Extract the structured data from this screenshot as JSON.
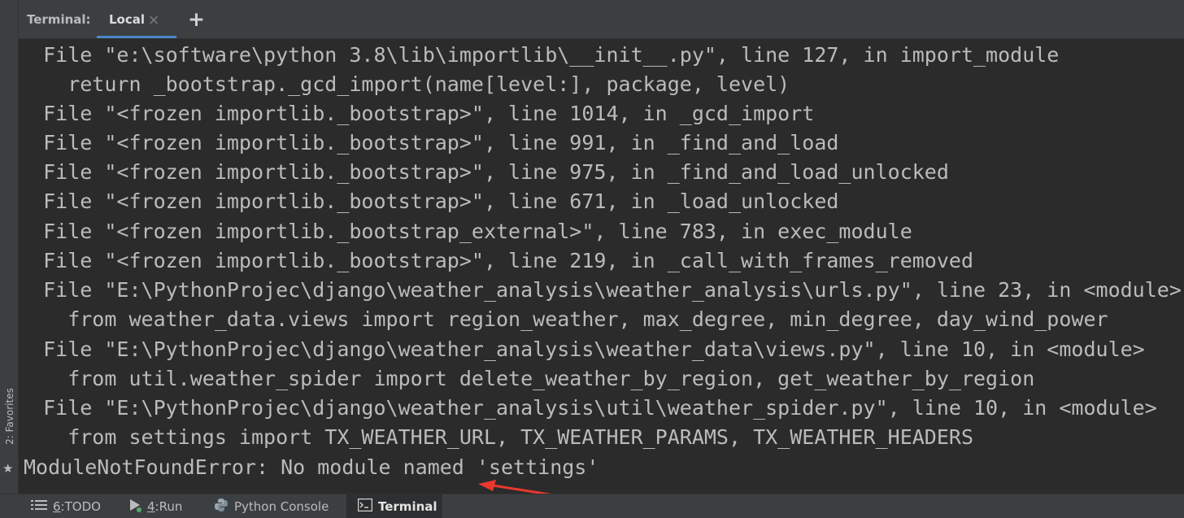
{
  "header": {
    "title": "Terminal:",
    "active_tab": "Local",
    "close_glyph": "×",
    "add_glyph": "+",
    "behind_text": "···"
  },
  "sidebar": {
    "favorites_label": "2: Favorites"
  },
  "terminal": {
    "lines": [
      "  File \"e:\\software\\python 3.8\\lib\\importlib\\__init__.py\", line 127, in import_module",
      "    return _bootstrap._gcd_import(name[level:], package, level)",
      "  File \"<frozen importlib._bootstrap>\", line 1014, in _gcd_import",
      "  File \"<frozen importlib._bootstrap>\", line 991, in _find_and_load",
      "  File \"<frozen importlib._bootstrap>\", line 975, in _find_and_load_unlocked",
      "  File \"<frozen importlib._bootstrap>\", line 671, in _load_unlocked",
      "  File \"<frozen importlib._bootstrap_external>\", line 783, in exec_module",
      "  File \"<frozen importlib._bootstrap>\", line 219, in _call_with_frames_removed",
      "  File \"E:\\PythonProjec\\django\\weather_analysis\\weather_analysis\\urls.py\", line 23, in <module>",
      "    from weather_data.views import region_weather, max_degree, min_degree, day_wind_power",
      "  File \"E:\\PythonProjec\\django\\weather_analysis\\weather_data\\views.py\", line 10, in <module>",
      "    from util.weather_spider import delete_weather_by_region, get_weather_by_region",
      "  File \"E:\\PythonProjec\\django\\weather_analysis\\util\\weather_spider.py\", line 10, in <module>",
      "    from settings import TX_WEATHER_URL, TX_WEATHER_PARAMS, TX_WEATHER_HEADERS",
      "ModuleNotFoundError: No module named 'settings'"
    ]
  },
  "bottom_tabs": [
    {
      "key": "6",
      "label": "TODO",
      "icon": "list-icon"
    },
    {
      "key": "4",
      "label": "Run",
      "icon": "run-icon"
    },
    {
      "key": "",
      "label": "Python Console",
      "icon": "python-icon"
    },
    {
      "key": "",
      "label": "Terminal",
      "icon": "terminal-icon"
    }
  ],
  "colors": {
    "background": "#2b2b2b",
    "panel": "#3c3f41",
    "text": "#bbbbbb",
    "accent": "#4a88c7",
    "arrow": "#e8382f"
  }
}
